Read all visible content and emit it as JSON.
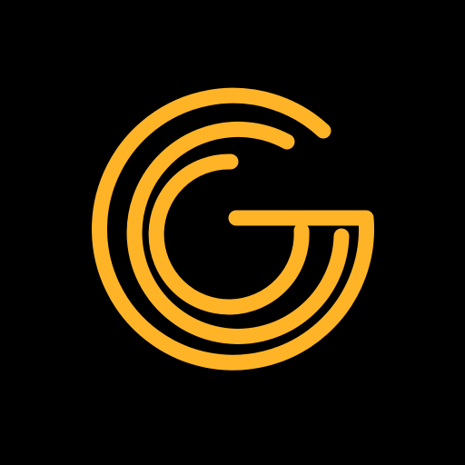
{
  "app_icon": {
    "icon": "concentric-g-logo-icon",
    "background_color": "#000000",
    "stroke_color": "#FFB427"
  }
}
